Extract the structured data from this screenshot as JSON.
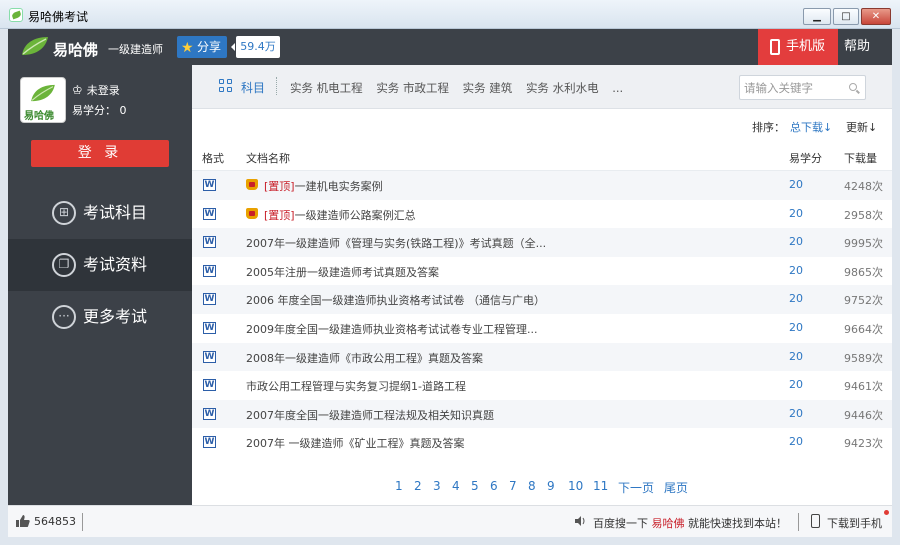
{
  "window": {
    "title": "易哈佛考试"
  },
  "header": {
    "brand": "易哈佛",
    "brand_sub": "一级建造师",
    "share_label": "分享",
    "share_count": "59.4万",
    "mobile_label": "手机版",
    "help_label": "帮助"
  },
  "user": {
    "avatar_text": "易哈佛",
    "status": "未登录",
    "points": "易学分： 0",
    "login_label": "登 录"
  },
  "sidebar": {
    "items": [
      {
        "label": "考试科目",
        "icon": "grid-icon"
      },
      {
        "label": "考试资料",
        "icon": "copy-icon"
      },
      {
        "label": "更多考试",
        "icon": "more-icon"
      }
    ]
  },
  "subjects": {
    "label": "科目",
    "tabs": [
      "实务 机电工程",
      "实务 市政工程",
      "实务 建筑",
      "实务 水利水电",
      "..."
    ]
  },
  "search": {
    "placeholder": "请输入关键字"
  },
  "sort": {
    "label": "排序：",
    "downloads": "总下载↓",
    "update": "更新↓"
  },
  "table": {
    "headers": [
      "格式",
      "文档名称",
      "易学分",
      "下载量"
    ],
    "rows": [
      {
        "pinned": true,
        "tag": "[置顶]",
        "title": "一建机电实务案例",
        "points": "20",
        "downloads": "4248次"
      },
      {
        "pinned": true,
        "tag": "[置顶]",
        "title": "一级建造师公路案例汇总",
        "points": "20",
        "downloads": "2958次"
      },
      {
        "pinned": false,
        "tag": "",
        "title": "2007年一级建造师《管理与实务(铁路工程)》考试真题（全...",
        "points": "20",
        "downloads": "9995次"
      },
      {
        "pinned": false,
        "tag": "",
        "title": "2005年注册一级建造师考试真题及答案",
        "points": "20",
        "downloads": "9865次"
      },
      {
        "pinned": false,
        "tag": "",
        "title": "2006 年度全国一级建造师执业资格考试试卷 （通信与广电）",
        "points": "20",
        "downloads": "9752次"
      },
      {
        "pinned": false,
        "tag": "",
        "title": "2009年度全国一级建造师执业资格考试试卷专业工程管理...",
        "points": "20",
        "downloads": "9664次"
      },
      {
        "pinned": false,
        "tag": "",
        "title": "2008年一级建造师《市政公用工程》真题及答案",
        "points": "20",
        "downloads": "9589次"
      },
      {
        "pinned": false,
        "tag": "",
        "title": "市政公用工程管理与实务复习提纲1-道路工程",
        "points": "20",
        "downloads": "9461次"
      },
      {
        "pinned": false,
        "tag": "",
        "title": "2007年度全国一级建造师工程法规及相关知识真题",
        "points": "20",
        "downloads": "9446次"
      },
      {
        "pinned": false,
        "tag": "",
        "title": "2007年 一级建造师《矿业工程》真题及答案",
        "points": "20",
        "downloads": "9423次"
      }
    ]
  },
  "pager": {
    "pages": [
      "1",
      "2",
      "3",
      "4",
      "5",
      "6",
      "7",
      "8",
      "9",
      "10",
      "11"
    ],
    "next": "下一页",
    "last": "尾页",
    "current": "1"
  },
  "status": {
    "likes": "564853",
    "notice_prefix": "百度搜一下",
    "notice_brand": "易哈佛",
    "notice_suffix": "就能快速找到本站！",
    "download_phone": "下载到手机"
  }
}
